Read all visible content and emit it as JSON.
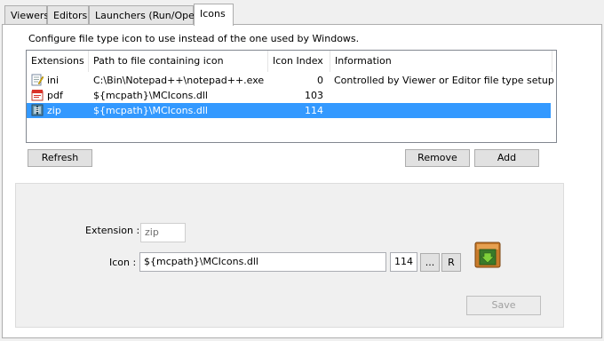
{
  "tabs": [
    {
      "label": "Viewers"
    },
    {
      "label": "Editors"
    },
    {
      "label": "Launchers (Run/Open)"
    },
    {
      "label": "Icons"
    }
  ],
  "description": "Configure file type icon to use instead of the one used by Windows.",
  "table": {
    "columns": [
      "Extensions",
      "Path to file containing icon",
      "Icon Index",
      "Information"
    ],
    "rows": [
      {
        "ext": "ini",
        "path": "C:\\Bin\\Notepad++\\notepad++.exe",
        "index": "0",
        "info": "Controlled by Viewer or Editor file type setup",
        "icon": "notepad-icon"
      },
      {
        "ext": "pdf",
        "path": "${mcpath}\\MCIcons.dll",
        "index": "103",
        "info": "",
        "icon": "pdf-icon"
      },
      {
        "ext": "zip",
        "path": "${mcpath}\\MCIcons.dll",
        "index": "114",
        "info": "",
        "icon": "zip-icon",
        "selected": true
      }
    ]
  },
  "buttons": {
    "refresh": "Refresh",
    "remove": "Remove",
    "add": "Add",
    "browse": "...",
    "reset": "R",
    "save": "Save"
  },
  "editor": {
    "extension_label": "Extension :",
    "extension_value": "zip",
    "icon_label": "Icon :",
    "icon_path": "${mcpath}\\MCIcons.dll",
    "icon_index": "114"
  },
  "colors": {
    "selection": "#3399ff",
    "tab_active": "#ffffff",
    "panel": "#ffffff"
  }
}
